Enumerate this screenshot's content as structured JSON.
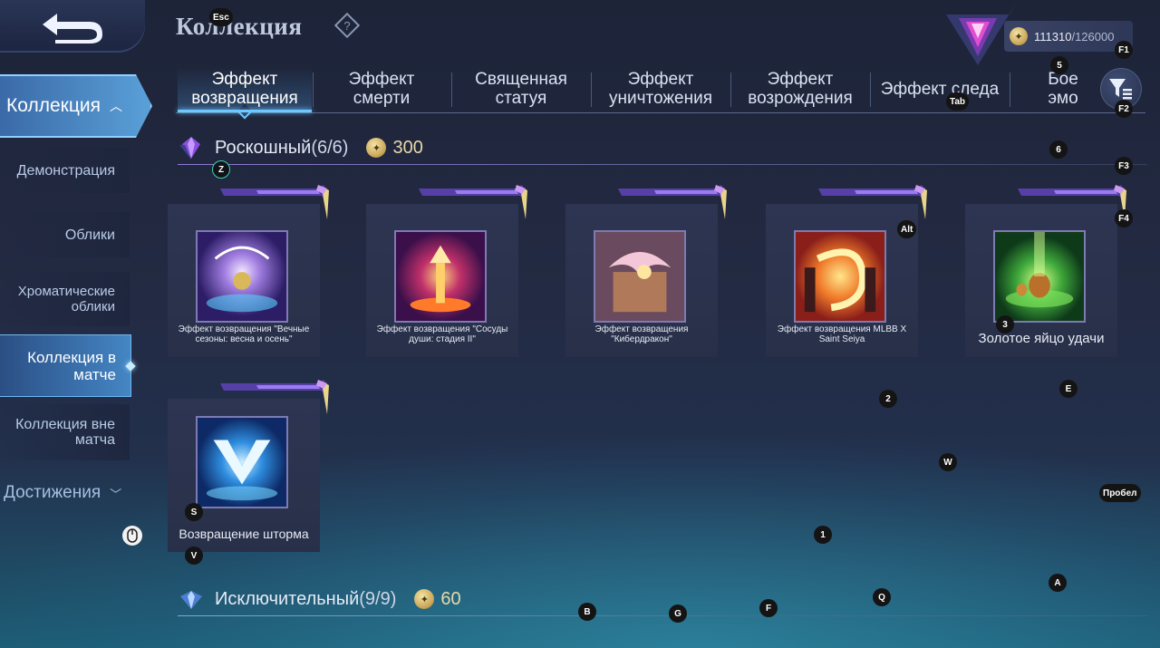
{
  "header": {
    "title": "Коллекция",
    "currency": {
      "value": "111310",
      "max": "/126000"
    }
  },
  "sidebar": {
    "active_section": "Коллекция",
    "items": [
      {
        "label": "Демонстрация"
      },
      {
        "label": "Облики"
      },
      {
        "label": "Хроматические облики"
      },
      {
        "label": "Коллекция в матче"
      },
      {
        "label": "Коллекция вне матча"
      }
    ],
    "achievements": "Достижения"
  },
  "tabs": [
    {
      "label": "Эффект возвращения"
    },
    {
      "label": "Эффект смерти"
    },
    {
      "label": "Священная статуя"
    },
    {
      "label": "Эффект уничтожения"
    },
    {
      "label": "Эффект возрождения"
    },
    {
      "label": "Эффект следа"
    },
    {
      "label": "Бое эмо"
    }
  ],
  "sections": [
    {
      "title": "Роскошный",
      "count": "(6/6)",
      "reward": "300",
      "items": [
        {
          "name": "Эффект возвращения \"Вечные сезоны: весна и осень\""
        },
        {
          "name": "Эффект возвращения \"Сосуды души: стадия II\""
        },
        {
          "name": "Эффект возвращения \"Кибердракон\""
        },
        {
          "name": "Эффект возвращения MLBB X Saint Seiya"
        },
        {
          "name": "Золотое яйцо удачи"
        },
        {
          "name": "Возвращение шторма"
        }
      ]
    },
    {
      "title": "Исключительный",
      "count": "(9/9)",
      "reward": "60"
    }
  ],
  "key_hints": {
    "esc": "Esc",
    "f1": "F1",
    "f2": "F2",
    "f3": "F3",
    "f4": "F4",
    "tab": "Tab",
    "alt": "Alt",
    "z": "Z",
    "s": "S",
    "v": "V",
    "e": "E",
    "w": "W",
    "a": "A",
    "b": "B",
    "g": "G",
    "f": "F",
    "q": "Q",
    "n1": "1",
    "n2": "2",
    "n3": "3",
    "n5": "5",
    "n6": "6",
    "space": "Пробел"
  },
  "colors": {
    "accent": "#6ec8ff",
    "gold": "#e7d9a8",
    "purple": "#8f7bd8"
  },
  "icons": [
    "back-arrow-icon",
    "help-icon",
    "rank-emblem-icon",
    "coin-icon",
    "filter-icon",
    "gem-icon",
    "mouse-icon"
  ]
}
